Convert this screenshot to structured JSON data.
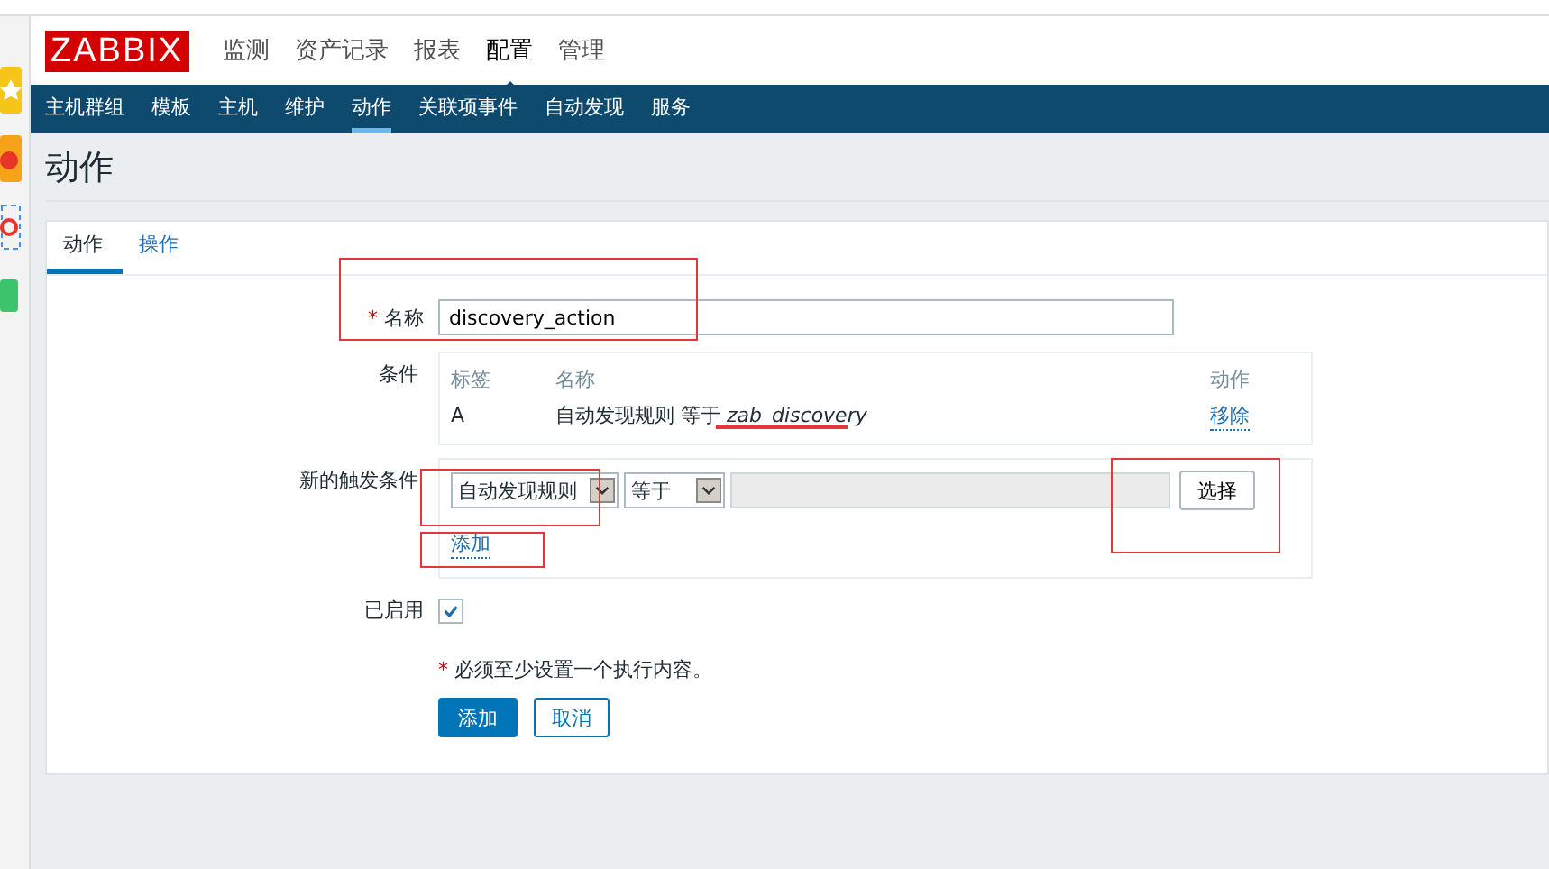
{
  "logo": "ZABBIX",
  "main_menu": [
    {
      "label": "监测",
      "selected": false
    },
    {
      "label": "资产记录",
      "selected": false
    },
    {
      "label": "报表",
      "selected": false
    },
    {
      "label": "配置",
      "selected": true
    },
    {
      "label": "管理",
      "selected": false
    }
  ],
  "sub_menu": [
    {
      "label": "主机群组",
      "selected": false
    },
    {
      "label": "模板",
      "selected": false
    },
    {
      "label": "主机",
      "selected": false
    },
    {
      "label": "维护",
      "selected": false
    },
    {
      "label": "动作",
      "selected": true
    },
    {
      "label": "关联项事件",
      "selected": false
    },
    {
      "label": "自动发现",
      "selected": false
    },
    {
      "label": "服务",
      "selected": false
    }
  ],
  "page_title": "动作",
  "tabs": [
    {
      "label": "动作",
      "selected": true
    },
    {
      "label": "操作",
      "selected": false
    }
  ],
  "form": {
    "name": {
      "required_mark": "*",
      "label": "名称",
      "value": "discovery_action"
    },
    "conditions": {
      "label": "条件",
      "columns": [
        "标签",
        "名称",
        "动作"
      ],
      "rows": [
        {
          "tag": "A",
          "text": "自动发现规则 等于",
          "value": "zab_discovery",
          "action": "移除"
        }
      ]
    },
    "new_condition": {
      "label": "新的触发条件",
      "type": "自动发现规则",
      "operator": "等于",
      "select_button": "选择",
      "add_link": "添加"
    },
    "enabled": {
      "label": "已启用",
      "checked": true
    },
    "note": {
      "mark": "*",
      "text": "必须至少设置一个执行内容。"
    },
    "buttons": [
      {
        "label": "添加",
        "kind": "primary"
      },
      {
        "label": "取消",
        "kind": "secondary"
      }
    ]
  }
}
